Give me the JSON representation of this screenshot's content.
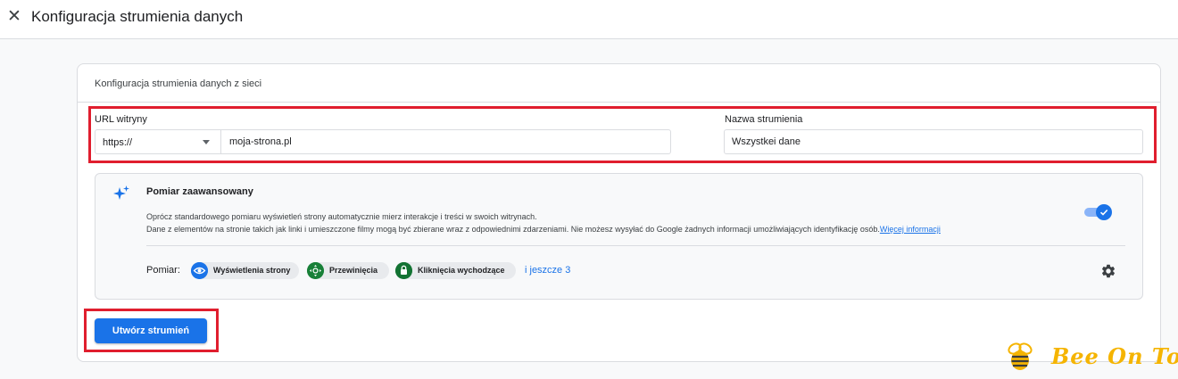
{
  "header": {
    "close_icon": "close-icon",
    "title": "Konfiguracja strumienia danych"
  },
  "card": {
    "header_text": "Konfiguracja strumienia danych z sieci"
  },
  "form": {
    "url_label": "URL witryny",
    "protocol_selected": "https://",
    "url_value": "moja-strona.pl",
    "name_label": "Nazwa strumienia",
    "name_value": "Wszystkei dane"
  },
  "advanced": {
    "icon": "sparkle-icon",
    "title": "Pomiar zaawansowany",
    "description_1": "Oprócz standardowego pomiaru wyświetleń strony automatycznie mierz interakcje i treści w swoich witrynach.",
    "description_2": "Dane z elementów na stronie takich jak linki i umieszczone filmy mogą być zbierane wraz z odpowiednimi zdarzeniami. Nie możesz wysyłać do Google żadnych informacji umożliwiających identyfikację osób.",
    "more_info_link": "Więcej informacji",
    "toggle_on": true,
    "measure_label": "Pomiar:",
    "chips": [
      {
        "label": "Wyświetlenia strony",
        "icon": "eye-icon"
      },
      {
        "label": "Przewinięcia",
        "icon": "scroll-target-icon"
      },
      {
        "label": "Kliknięcia wychodzące",
        "icon": "mouse-lock-icon"
      }
    ],
    "more_chips": "i jeszcze 3",
    "settings_icon": "gear-icon"
  },
  "actions": {
    "create_button": "Utwórz strumień"
  },
  "watermark": {
    "text": "Bee On Top"
  },
  "colors": {
    "accent": "#1a73e8",
    "highlight": "#e01e2e",
    "watermark": "#f5b400"
  }
}
